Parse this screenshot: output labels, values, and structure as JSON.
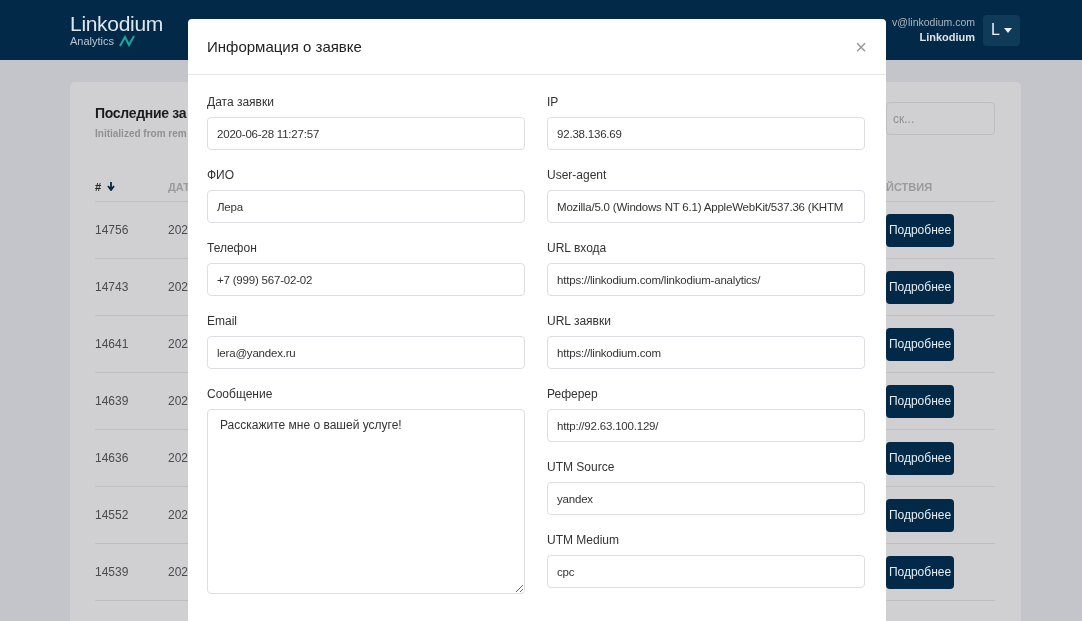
{
  "header": {
    "logo": {
      "name": "Linkodium",
      "tagline": "Analytics"
    },
    "user": {
      "email": "v@linkodium.com",
      "company": "Linkodium",
      "avatar": "L"
    }
  },
  "card": {
    "title": "Последние за",
    "subtitle": "Initialized from rem",
    "search": {
      "placeholder": "ск..."
    },
    "columns": [
      {
        "label": "#",
        "sorted": true
      },
      {
        "label": "ДАТ",
        "sorted": false
      },
      {
        "label": "ЙСТВИЯ",
        "sorted": false
      }
    ],
    "rows": [
      {
        "id": "14756",
        "date": "202",
        "action": "Подробнее"
      },
      {
        "id": "14743",
        "date": "202",
        "action": "Подробнее"
      },
      {
        "id": "14641",
        "date": "202",
        "action": "Подробнее"
      },
      {
        "id": "14639",
        "date": "202",
        "action": "Подробнее"
      },
      {
        "id": "14636",
        "date": "202",
        "action": "Подробнее"
      },
      {
        "id": "14552",
        "date": "202",
        "action": "Подробнее"
      },
      {
        "id": "14539",
        "date": "202",
        "action": "Подробнее"
      }
    ]
  },
  "modal": {
    "title": "Информация о заявке",
    "close": "×",
    "left_fields": [
      {
        "kind": "input",
        "label": "Дата заявки",
        "value": "2020-06-28 11:27:57"
      },
      {
        "kind": "input",
        "label": "ФИО",
        "value": "Лера"
      },
      {
        "kind": "input",
        "label": "Телефон",
        "value": "+7 (999) 567-02-02"
      },
      {
        "kind": "input",
        "label": "Email",
        "value": "lera@yandex.ru"
      },
      {
        "kind": "textarea",
        "label": "Сообщение",
        "value": "Расскажите мне о вашей услуге!"
      }
    ],
    "right_fields": [
      {
        "kind": "input",
        "label": "IP",
        "value": "92.38.136.69"
      },
      {
        "kind": "input",
        "label": "User-agent",
        "value": "Mozilla/5.0 (Windows NT 6.1) AppleWebKit/537.36 (KHTM"
      },
      {
        "kind": "input",
        "label": "URL входа",
        "value": "https://linkodium.com/linkodium-analytics/"
      },
      {
        "kind": "input",
        "label": "URL заявки",
        "value": "https://linkodium.com"
      },
      {
        "kind": "input",
        "label": "Реферер",
        "value": "http://92.63.100.129/"
      },
      {
        "kind": "input",
        "label": "UTM Source",
        "value": "yandex"
      },
      {
        "kind": "input",
        "label": "UTM Medium",
        "value": "cpc"
      }
    ]
  }
}
